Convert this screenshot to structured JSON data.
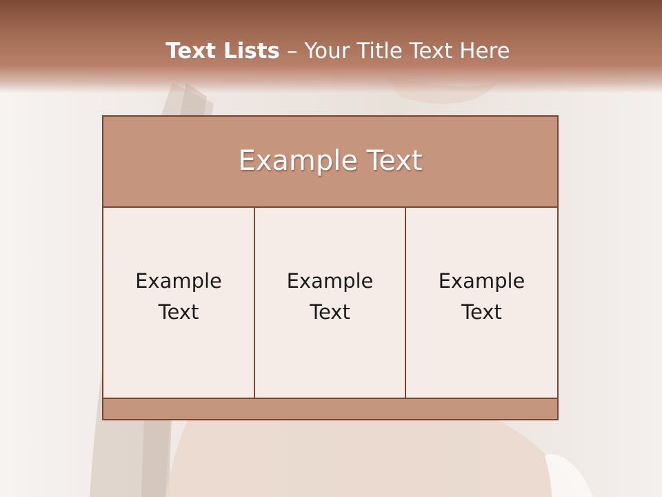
{
  "slide": {
    "title_bold": "Text Lists",
    "title_rest": "– Your Title Text Here"
  },
  "diagram": {
    "header": "Example Text",
    "columns": [
      {
        "label": "Example Text"
      },
      {
        "label": "Example Text"
      },
      {
        "label": "Example Text"
      }
    ]
  },
  "colors": {
    "header_band": "#a06a53",
    "accent_fill": "#c5957e",
    "border": "#7a4433",
    "cell_fill": "#f5ebe7"
  }
}
